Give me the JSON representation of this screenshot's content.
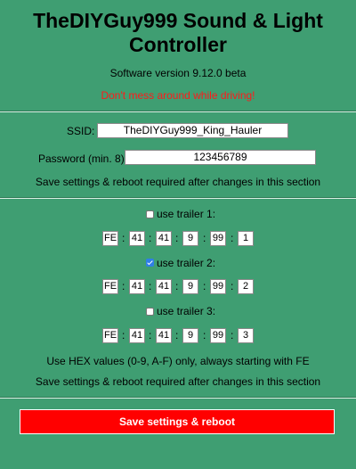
{
  "header": {
    "title": "TheDIYGuy999 Sound & Light Controller",
    "version": "Software version 9.12.0 beta",
    "warning": "Don't mess around while driving!"
  },
  "wifi": {
    "ssid_label": "SSID:",
    "ssid_value": "TheDIYGuy999_King_Hauler",
    "password_label": "Password (min. 8):",
    "password_value": "123456789",
    "note": "Save settings & reboot required after changes in this section"
  },
  "trailers": [
    {
      "label": "use trailer 1:",
      "checked": false,
      "mac": [
        "FE",
        "41",
        "41",
        "9",
        "99",
        "1"
      ]
    },
    {
      "label": "use trailer 2:",
      "checked": true,
      "mac": [
        "FE",
        "41",
        "41",
        "9",
        "99",
        "2"
      ]
    },
    {
      "label": "use trailer 3:",
      "checked": false,
      "mac": [
        "FE",
        "41",
        "41",
        "9",
        "99",
        "3"
      ]
    }
  ],
  "trailer_notes": {
    "hex_hint": "Use HEX values (0-9, A-F) only, always starting with FE",
    "reboot_note": "Save settings & reboot required after changes in this section"
  },
  "colon": ":",
  "save_button": "Save settings & reboot"
}
